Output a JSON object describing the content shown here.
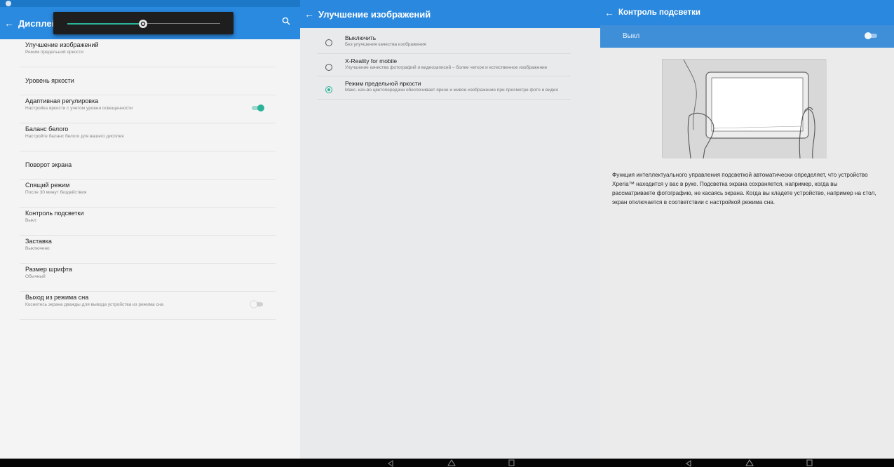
{
  "status": {
    "time": ""
  },
  "display": {
    "title": "Дисплей",
    "brightness_level": 0.5,
    "items": [
      {
        "title": "Улучшение изображений",
        "subtitle": "Режим предельной яркости"
      },
      {
        "title": "Уровень яркости",
        "subtitle": ""
      },
      {
        "title": "Адаптивная регулировка",
        "subtitle": "Настройка яркости с учетом уровня освещенности",
        "toggle": "on"
      },
      {
        "title": "Баланс белого",
        "subtitle": "Настройте баланс белого для вашего дисплея"
      },
      {
        "title": "Поворот экрана",
        "subtitle": ""
      },
      {
        "title": "Спящий режим",
        "subtitle": "После 30 минут бездействия"
      },
      {
        "title": "Контроль подсветки",
        "subtitle": "Выкл"
      },
      {
        "title": "Заставка",
        "subtitle": "Выключено"
      },
      {
        "title": "Размер шрифта",
        "subtitle": "Обычный"
      },
      {
        "title": "Выход из режима сна",
        "subtitle": "Коснитесь экрана дважды для вывода устройства из режима сна",
        "toggle": "off"
      }
    ]
  },
  "image_enhancement": {
    "title": "Улучшение изображений",
    "options": [
      {
        "title": "Выключить",
        "subtitle": "Без улучшения качества изображения",
        "selected": false
      },
      {
        "title": "X-Reality for mobile",
        "subtitle": "Улучшение качества фотографий и видеозаписей – более четкое и естественное изображение",
        "selected": false
      },
      {
        "title": "Режим предельной яркости",
        "subtitle": "Макс. кач-во цветопередачи обеспечивает яркое и живое изображение при просмотре фото и видео",
        "selected": true
      }
    ]
  },
  "backlight": {
    "title": "Контроль подсветки",
    "state_label": "Выкл",
    "description": "Функция интеллектуального управления подсветкой автоматически определяет, что устройство Xperia™ находится у вас в руке. Подсветка экрана сохраняется, например, когда вы рассматриваете фотографию, не касаясь экрана. Когда вы кладете устройство, например на стол, экран отключается в соответствии с настройкой режима сна."
  },
  "colors": {
    "primary": "#2a8ae0",
    "accent": "#2bb39a",
    "navbar": "#050505"
  },
  "icons": {
    "back": "←",
    "search": "search-icon",
    "nav_back": "◁",
    "nav_home": "△",
    "nav_recents": "□"
  }
}
